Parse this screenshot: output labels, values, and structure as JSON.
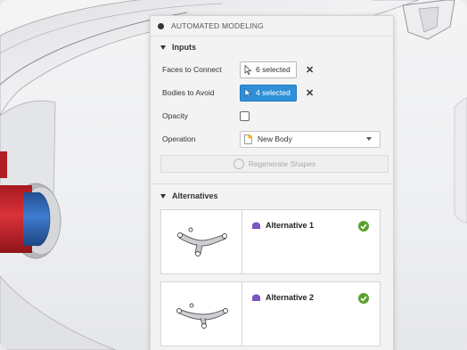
{
  "panel": {
    "title": "AUTOMATED MODELING",
    "inputs_section": "Inputs",
    "faces_label": "Faces to Connect",
    "faces_value": "6 selected",
    "bodies_label": "Bodies to Avoid",
    "bodies_value": "4 selected",
    "opacity_label": "Opacity",
    "opacity_checked": false,
    "operation_label": "Operation",
    "operation_value": "New Body",
    "regenerate_label": "Regenerate Shapes",
    "alternatives_section": "Alternatives",
    "alternatives": [
      {
        "label": "Alternative 1",
        "status": "complete"
      },
      {
        "label": "Alternative 2",
        "status": "complete"
      }
    ]
  },
  "colors": {
    "accent": "#2f8fd8",
    "success": "#5aa12e",
    "body_purple": "#7a55c6",
    "model_red": "#c8242b",
    "model_blue": "#2f68b8"
  },
  "icons": {
    "header": "panel-dot-icon",
    "select": "cursor-arrow-icon",
    "clear": "close-icon",
    "operation": "new-body-icon",
    "regenerate": "regenerate-icon",
    "alternative_body": "body-icon",
    "status": "checkmark-icon"
  }
}
